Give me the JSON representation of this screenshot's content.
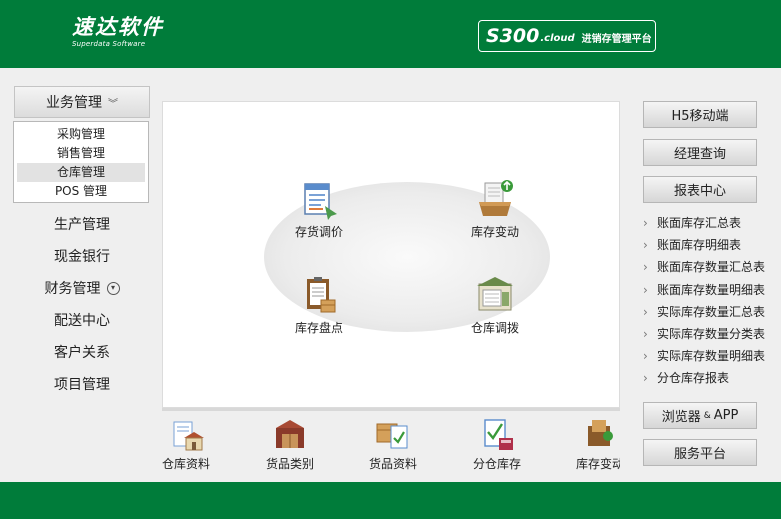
{
  "header": {
    "logo_cn": "速达软件",
    "logo_en": "Superdata Software",
    "badge_code": "S300",
    "badge_cloud": ".cloud",
    "badge_text": "进销存管理平台"
  },
  "left_nav": {
    "active": "业务管理",
    "submenu": [
      "采购管理",
      "销售管理",
      "仓库管理",
      "POS 管理"
    ],
    "selected_sub": "仓库管理",
    "items": [
      "生产管理",
      "现金银行",
      "财务管理",
      "配送中心",
      "客户关系",
      "项目管理"
    ]
  },
  "center": {
    "functions": [
      "存货调价",
      "库存变动",
      "库存盘点",
      "仓库调拨"
    ]
  },
  "quick": [
    "仓库资料",
    "货品类别",
    "货品资料",
    "分仓库存",
    "库存变动"
  ],
  "right": {
    "buttons": [
      "H5移动端",
      "经理查询",
      "报表中心"
    ],
    "reports": [
      "账面库存汇总表",
      "账面库存明细表",
      "账面库存数量汇总表",
      "账面库存数量明细表",
      "实际库存数量汇总表",
      "实际库存数量分类表",
      "实际库存数量明细表",
      "分仓库存报表"
    ],
    "browser_a": "浏览器",
    "browser_amp": "&",
    "browser_b": "APP",
    "service": "服务平台"
  },
  "colors": {
    "brand_green": "#007c3a"
  }
}
